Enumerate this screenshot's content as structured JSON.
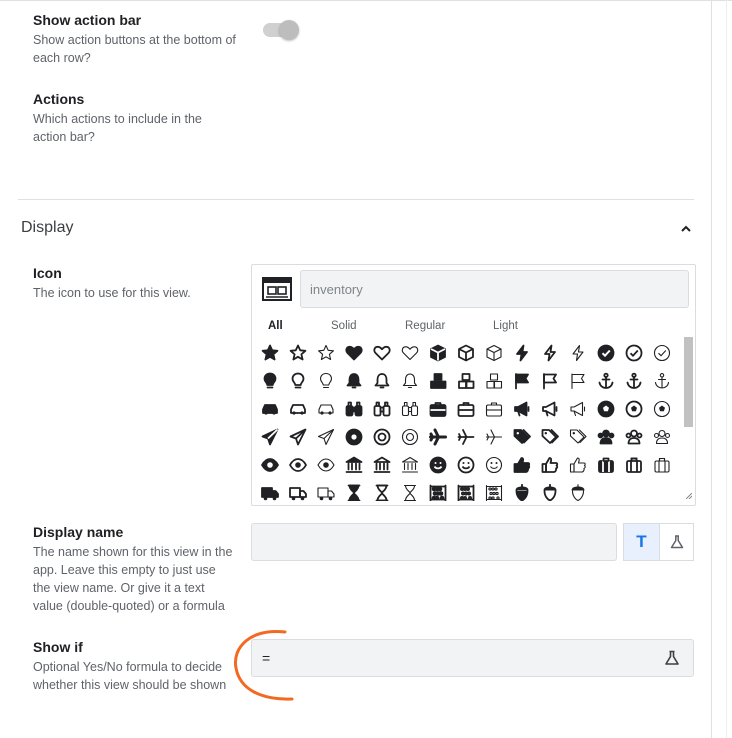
{
  "action_bar": {
    "title": "Show action bar",
    "description": "Show action buttons at the bottom of each row?",
    "enabled": false
  },
  "actions": {
    "title": "Actions",
    "description": "Which actions to include in the action bar?"
  },
  "display_section": {
    "title": "Display",
    "expanded": true
  },
  "icon_field": {
    "title": "Icon",
    "description": "The icon to use for this view.",
    "search_value": "inventory",
    "tabs": [
      "All",
      "Solid",
      "Regular",
      "Light"
    ],
    "active_tab": "All",
    "icon_names": [
      "star-solid",
      "star-regular",
      "star-light",
      "heart-solid",
      "heart-regular",
      "heart-light",
      "cube-solid",
      "cube-regular",
      "cube-light",
      "bolt-solid",
      "bolt-regular",
      "bolt-light",
      "check-circle-solid",
      "check-circle-regular",
      "check-circle-light",
      "lightbulb-solid",
      "lightbulb-regular",
      "lightbulb-light",
      "bell-solid",
      "bell-regular",
      "bell-light",
      "cubes-solid",
      "cubes-regular",
      "cubes-light",
      "flag-solid",
      "flag-regular",
      "flag-light",
      "anchor-solid",
      "anchor-regular",
      "anchor-light",
      "car-solid",
      "car-regular",
      "car-light",
      "binoculars-solid",
      "binoculars-regular",
      "binoculars-light",
      "briefcase-solid",
      "briefcase-regular",
      "briefcase-light",
      "megaphone-solid",
      "megaphone-regular",
      "megaphone-light",
      "futbol-solid",
      "futbol-regular",
      "futbol-light",
      "paper-plane-solid",
      "paper-plane-regular",
      "paper-plane-light",
      "life-ring-solid",
      "life-ring-regular",
      "life-ring-light",
      "plane-solid",
      "plane-regular",
      "plane-light",
      "tags-solid",
      "tags-regular",
      "tags-light",
      "users-solid",
      "users-regular",
      "users-light",
      "eye-solid",
      "eye-regular",
      "eye-light",
      "university-solid",
      "university-regular",
      "university-light",
      "smile-solid",
      "smile-regular",
      "smile-light",
      "thumbs-up-solid",
      "thumbs-up-regular",
      "thumbs-up-light",
      "suitcase-solid",
      "suitcase-regular",
      "suitcase-light",
      "truck-solid",
      "truck-regular",
      "truck-light",
      "hourglass-solid",
      "hourglass-regular",
      "hourglass-light",
      "abacus-solid",
      "abacus-regular",
      "abacus-light",
      "acorn-solid",
      "acorn-regular",
      "acorn-light"
    ]
  },
  "display_name": {
    "title": "Display name",
    "description": "The name shown for this view in the app. Leave this empty to just use the view name. Or give it a text value (double-quoted) or a formula",
    "value": "",
    "text_mode_label": "T",
    "mode_icons": [
      "text-mode-icon",
      "flask-icon"
    ]
  },
  "show_if": {
    "title": "Show if",
    "description": "Optional Yes/No formula to decide whether this view should be shown",
    "value": "=",
    "icon": "flask-icon"
  },
  "colors": {
    "accent": "#1a73e8",
    "annotation": "#f26a21",
    "field_bg": "#f1f3f4"
  }
}
